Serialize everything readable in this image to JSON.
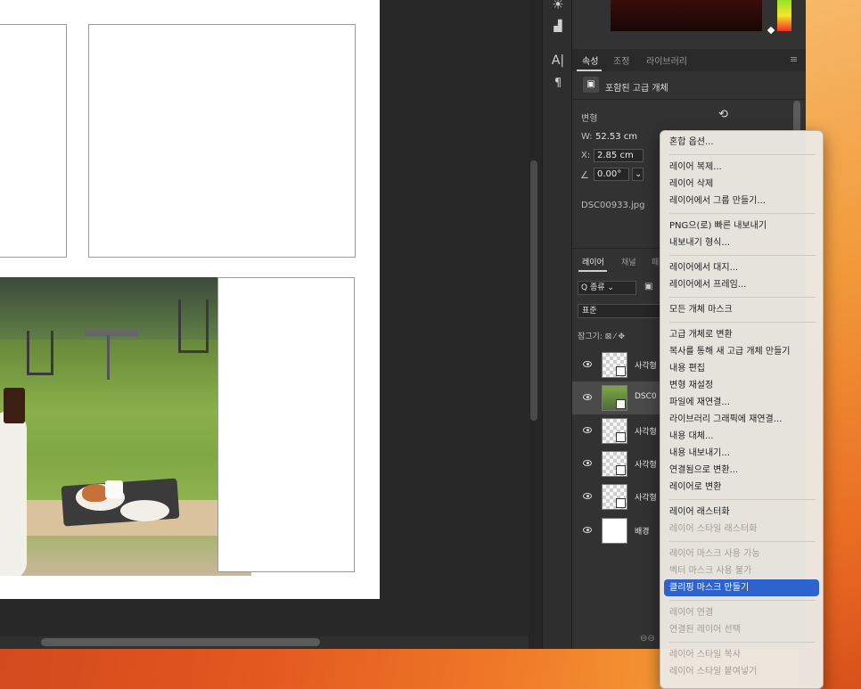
{
  "properties_panel": {
    "tabs": [
      "속성",
      "조정",
      "라이브러리"
    ],
    "active_tab": "속성",
    "object_type": "포함된 고급 개체",
    "section_label": "변형",
    "width_label": "W:",
    "width_value": "52.53 cm",
    "x_label": "X:",
    "x_value": "2.85 cm",
    "angle_value": "0.00°",
    "angle_dropdown": "⌄",
    "filename": "DSC00933.jpg"
  },
  "layers_panel": {
    "tabs": [
      "레이어",
      "채널",
      "패"
    ],
    "kind_filter": "Q 종류   ⌄",
    "blend_mode": "표준",
    "lock_label": "잠그기:",
    "lock_icons": "⊠  ⁄  ✥",
    "layers": [
      {
        "name": "사각형",
        "thumb": "transparent",
        "selected": false
      },
      {
        "name": "DSC0",
        "thumb": "photo",
        "selected": true
      },
      {
        "name": "사각형",
        "thumb": "transparent",
        "selected": false
      },
      {
        "name": "사각형",
        "thumb": "transparent",
        "selected": false
      },
      {
        "name": "사각형",
        "thumb": "transparent",
        "selected": false
      },
      {
        "name": "배경",
        "thumb": "white",
        "selected": false
      }
    ]
  },
  "tools": {
    "icons": [
      "sun-icon",
      "histogram-icon",
      "character-icon",
      "paragraph-icon"
    ],
    "glyphs": [
      "☀",
      "▟",
      "A|",
      "¶"
    ]
  },
  "context_menu": {
    "items": [
      {
        "label": "혼합 옵션...",
        "disabled": false
      },
      {
        "sep": true
      },
      {
        "label": "레이어 복제...",
        "disabled": false
      },
      {
        "label": "레이어 삭제",
        "disabled": false
      },
      {
        "label": "레이어에서 그룹 만들기...",
        "disabled": false
      },
      {
        "sep": true
      },
      {
        "label": "PNG으(로) 빠른 내보내기",
        "disabled": false
      },
      {
        "label": "내보내기 형식...",
        "disabled": false
      },
      {
        "sep": true
      },
      {
        "label": "레이어에서 대지...",
        "disabled": false
      },
      {
        "label": "레이어에서 프레임...",
        "disabled": false
      },
      {
        "sep": true
      },
      {
        "label": "모든 개체 마스크",
        "disabled": false
      },
      {
        "sep": true
      },
      {
        "label": "고급 개체로 변환",
        "disabled": false
      },
      {
        "label": "복사를 통해 새 고급 개체 만들기",
        "disabled": false
      },
      {
        "label": "내용 편집",
        "disabled": false
      },
      {
        "label": "변형 재설정",
        "disabled": false
      },
      {
        "label": "파일에 재연결...",
        "disabled": false
      },
      {
        "label": "라이브러리 그래픽에 재연결...",
        "disabled": false
      },
      {
        "label": "내용 대체...",
        "disabled": false
      },
      {
        "label": "내용 내보내기...",
        "disabled": false
      },
      {
        "label": "연결됨으로 변환...",
        "disabled": false
      },
      {
        "label": "레이어로 변환",
        "disabled": false
      },
      {
        "sep": true
      },
      {
        "label": "레이어 래스터화",
        "disabled": false
      },
      {
        "label": "레이어 스타일 래스터화",
        "disabled": true
      },
      {
        "sep": true
      },
      {
        "label": "레이어 마스크 사용 가능",
        "disabled": true
      },
      {
        "label": "벡터 마스크 사용 불가",
        "disabled": true
      },
      {
        "label": "클리핑 마스크 만들기",
        "disabled": false,
        "highlight": true
      },
      {
        "sep": true
      },
      {
        "label": "레이어 연결",
        "disabled": true
      },
      {
        "label": "연결된 레이어 선택",
        "disabled": true
      },
      {
        "sep": true
      },
      {
        "label": "레이어 스타일 복사",
        "disabled": true
      },
      {
        "label": "레이어 스타일 붙여넣기",
        "disabled": true
      }
    ]
  },
  "colors": {
    "highlight": "#2d63d0",
    "panel_bg": "#323232",
    "menu_bg": "#ece8e2"
  }
}
